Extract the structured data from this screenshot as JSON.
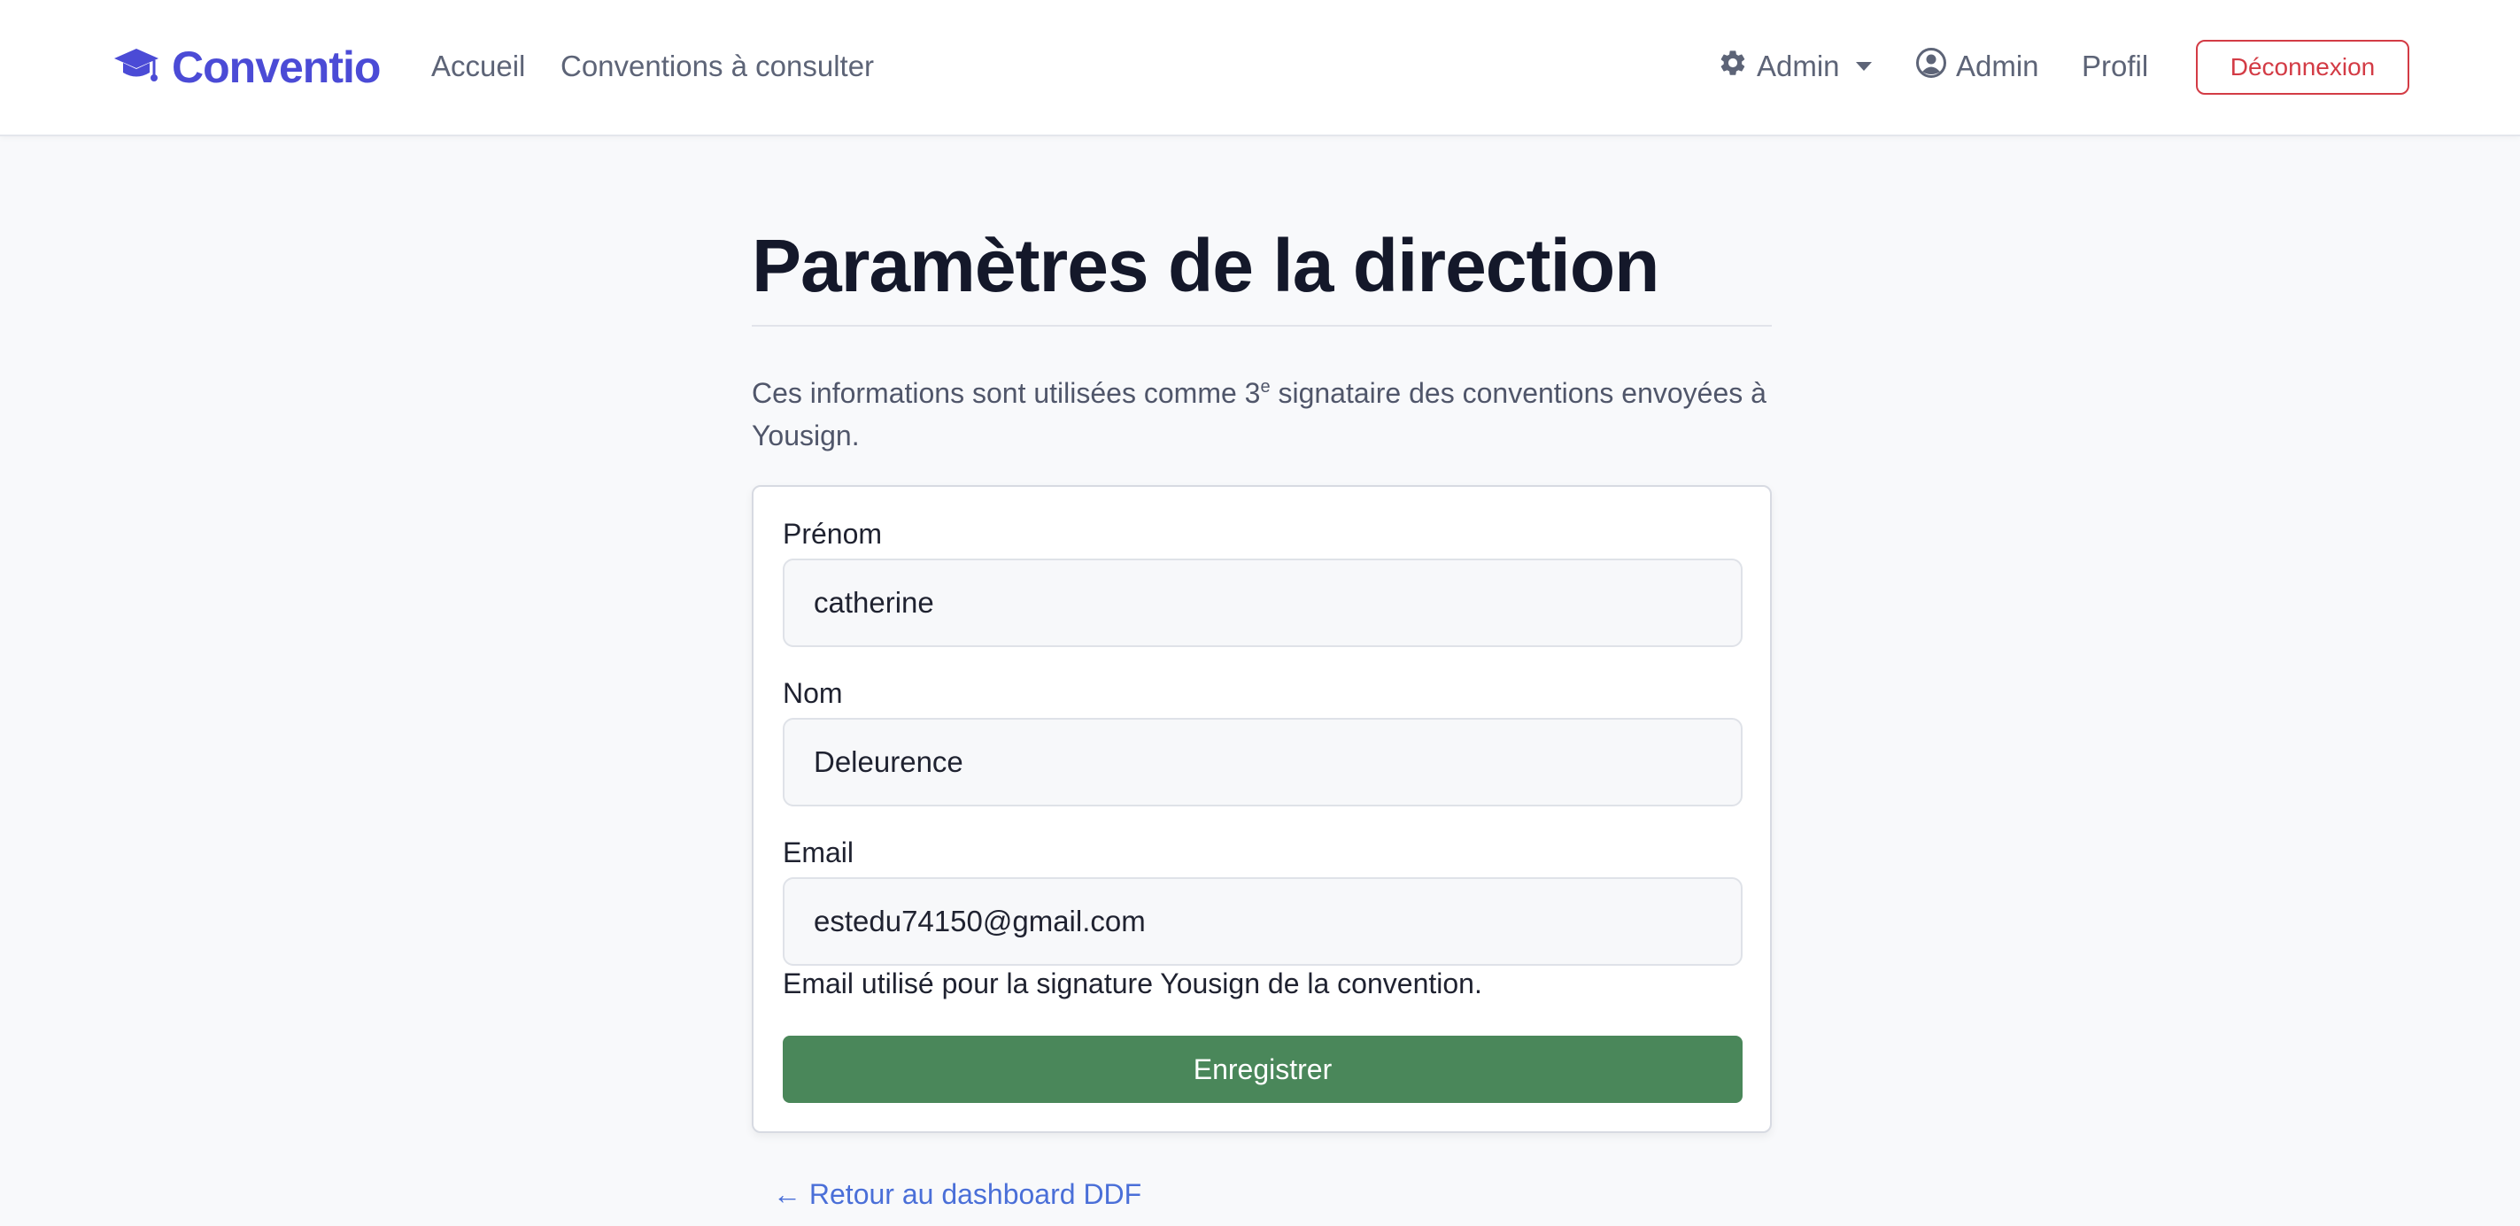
{
  "navbar": {
    "brand": "Conventio",
    "links": {
      "accueil": "Accueil",
      "conventions": "Conventions à consulter"
    },
    "admin_menu": "Admin",
    "user_name": "Admin",
    "profil": "Profil",
    "logout": "Déconnexion"
  },
  "page": {
    "title": "Paramètres de la direction",
    "intro_before_sup": "Ces informations sont utilisées comme 3",
    "intro_sup": "e",
    "intro_after_sup": " signataire des conventions envoyées à Yousign."
  },
  "form": {
    "prenom": {
      "label": "Prénom",
      "value": "catherine"
    },
    "nom": {
      "label": "Nom",
      "value": "Deleurence"
    },
    "email": {
      "label": "Email",
      "value": "estedu74150@gmail.com",
      "help": "Email utilisé pour la signature Yousign de la convention."
    },
    "submit": "Enregistrer"
  },
  "back_link": "← Retour au dashboard DDF",
  "colors": {
    "brand": "#4b4bd6",
    "primary_green": "#4a875a",
    "danger": "#d33b45",
    "link": "#4a6fd8"
  },
  "icons": {
    "brand": "graduation-cap-icon",
    "admin_menu": "gear-icon",
    "user": "user-circle-icon"
  }
}
